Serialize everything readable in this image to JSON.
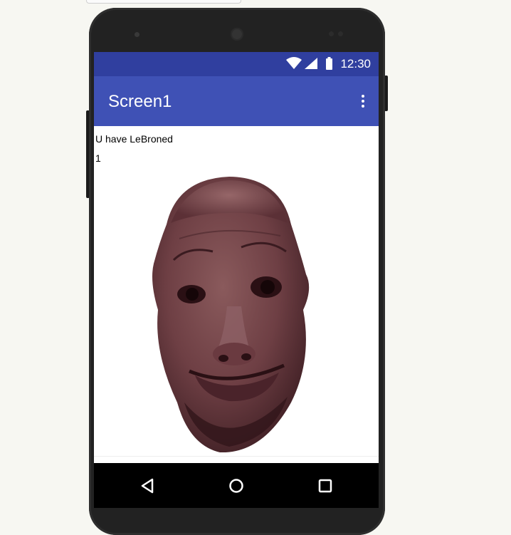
{
  "status_bar": {
    "time": "12:30",
    "icons": [
      "wifi-icon",
      "cellular-signal-icon",
      "battery-icon"
    ],
    "color": "#303f9f"
  },
  "app_bar": {
    "title": "Screen1",
    "menu_icon": "overflow-menu-icon",
    "color": "#3f51b5"
  },
  "content": {
    "label_text": "U have LeBroned",
    "count_text": "1",
    "image": "face-photo"
  },
  "nav_bar": {
    "buttons": [
      "back-triangle-icon",
      "home-circle-icon",
      "recents-square-icon"
    ]
  }
}
